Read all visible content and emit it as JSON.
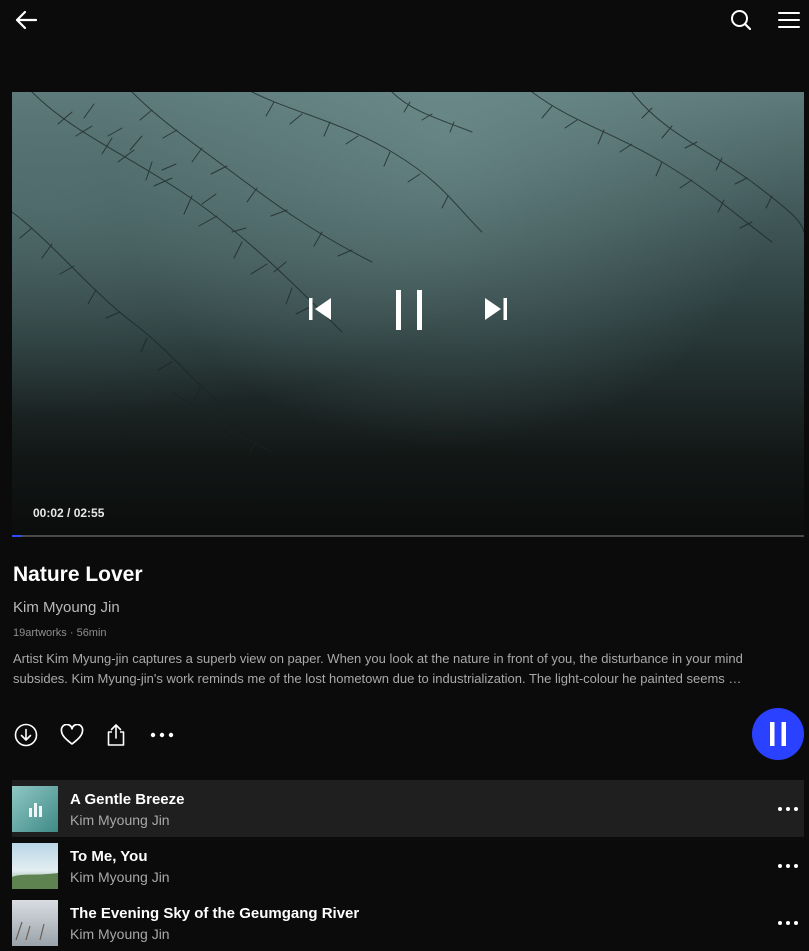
{
  "icons": {
    "back": "back-arrow-icon",
    "search": "search-icon",
    "menu": "hamburger-menu-icon",
    "prev": "skip-previous-icon",
    "pause": "pause-icon",
    "next": "skip-next-icon",
    "download": "download-icon",
    "like": "heart-icon",
    "share": "share-icon",
    "more": "more-horizontal-icon"
  },
  "player": {
    "time": "00:02 / 02:55",
    "progress": 0.012
  },
  "album": {
    "title": "Nature Lover",
    "artist": "Kim Myoung Jin",
    "meta": "19artworks · 56min",
    "description": "Artist Kim Myung-jin captures a superb view on paper. When you look at the nature in front of you, the disturbance in your mind subsides. Kim Myung-jin's work reminds me of the lost hometown due to industrialization. The light-colour he painted seems …"
  },
  "tracks": [
    {
      "title": "A Gentle Breeze",
      "artist": "Kim Myoung Jin",
      "playing": true
    },
    {
      "title": "To Me, You",
      "artist": "Kim Myoung Jin",
      "playing": false
    },
    {
      "title": "The Evening Sky of the Geumgang River",
      "artist": "Kim Myoung Jin",
      "playing": false
    }
  ],
  "colors": {
    "background": "#0b0b0b",
    "accent": "#2a42ff",
    "active_row": "#1f1f1f"
  }
}
